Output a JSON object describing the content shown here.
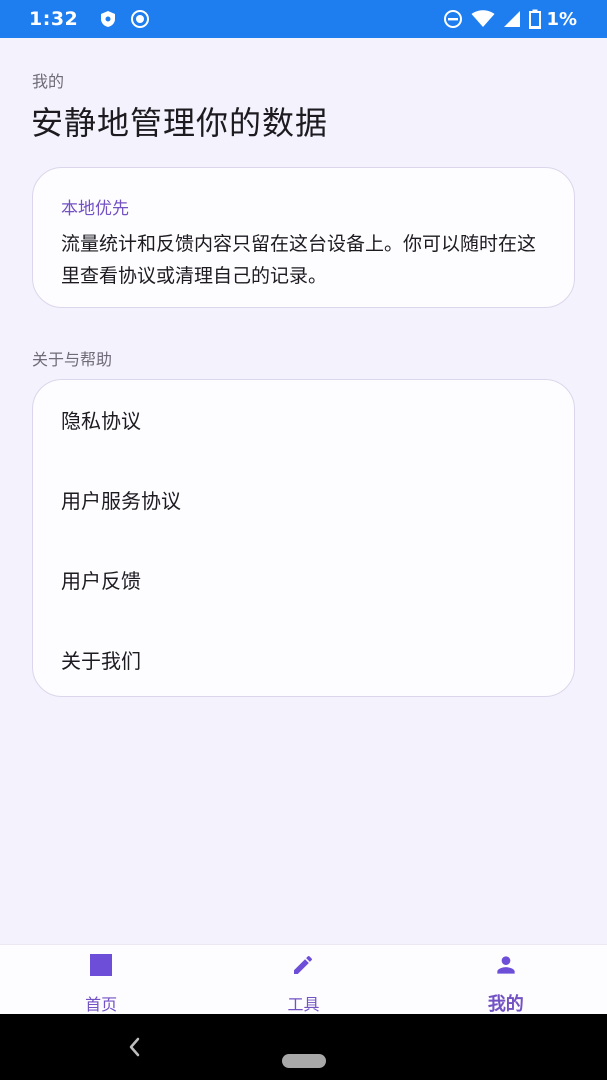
{
  "status_bar": {
    "time": "1:32",
    "battery": "1%",
    "icons": [
      "vpn-shield-icon",
      "screen-record-icon",
      "do-not-disturb-icon",
      "wifi-icon",
      "cellular-signal-icon",
      "battery-icon"
    ]
  },
  "header": {
    "eyebrow": "我的",
    "title": "安静地管理你的数据"
  },
  "info_card": {
    "label": "本地优先",
    "text": "流量统计和反馈内容只留在这台设备上。你可以随时在这里查看协议或清理自己的记录。"
  },
  "about_section": {
    "label": "关于与帮助",
    "items": [
      {
        "label": "隐私协议"
      },
      {
        "label": "用户服务协议"
      },
      {
        "label": "用户反馈"
      },
      {
        "label": "关于我们"
      }
    ]
  },
  "bottom_nav": {
    "items": [
      {
        "label": "首页",
        "icon": "home-square-icon",
        "active": false
      },
      {
        "label": "工具",
        "icon": "pencil-icon",
        "active": false
      },
      {
        "label": "我的",
        "icon": "person-icon",
        "active": true
      }
    ]
  },
  "colors": {
    "status_bar": "#1e7ef0",
    "background": "#f4f2fc",
    "accent": "#7352c4",
    "card": "#fdfcff"
  }
}
